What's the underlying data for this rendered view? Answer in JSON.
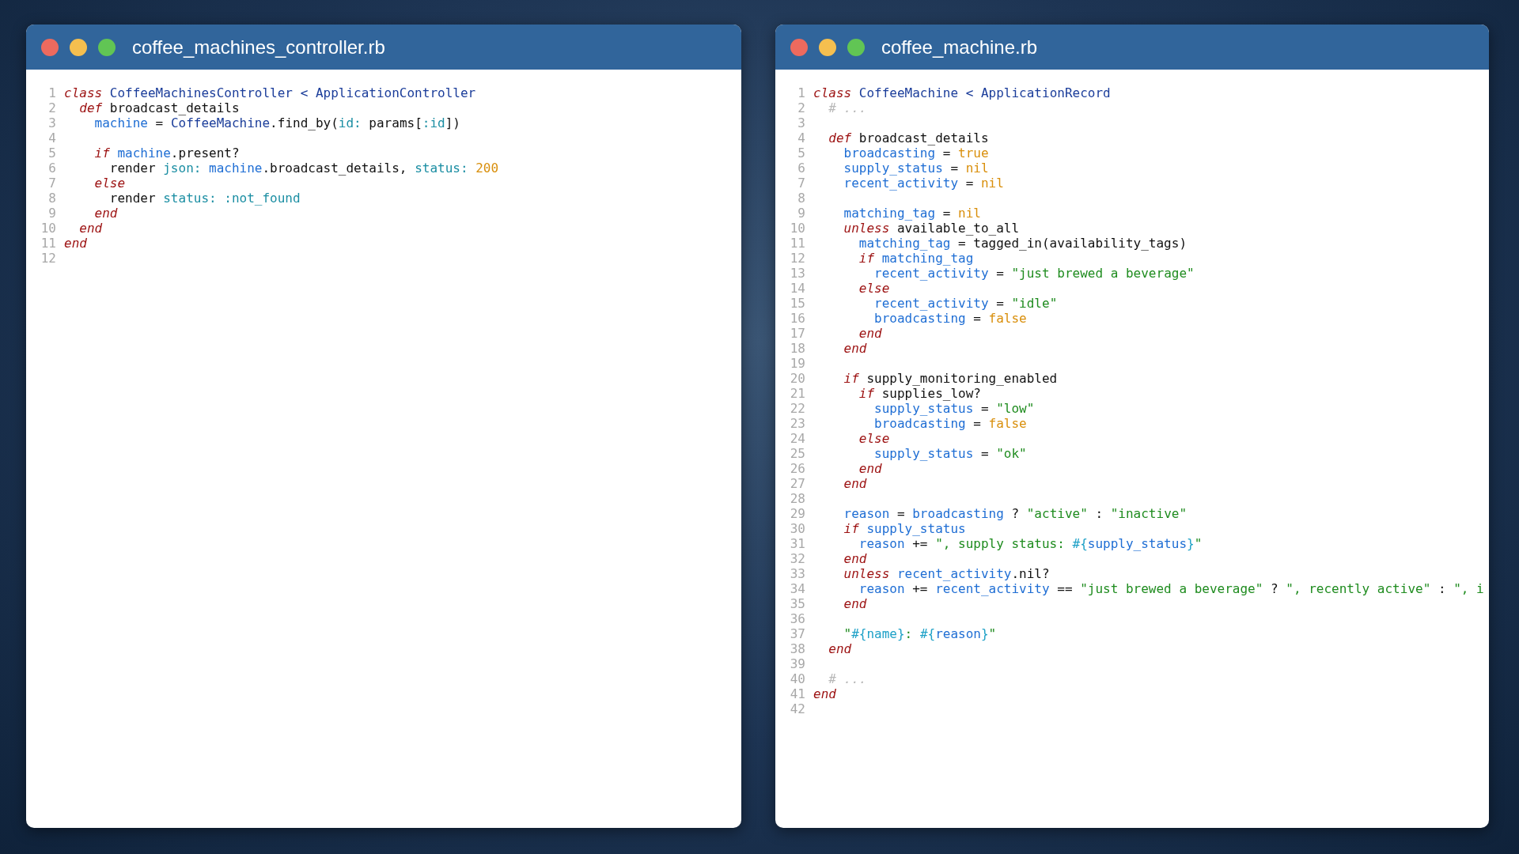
{
  "windows": [
    {
      "title": "coffee_machines_controller.rb",
      "lines": [
        {
          "number": "1",
          "tokens": [
            {
              "kind": "keyword",
              "text": "class"
            },
            {
              "kind": "constant",
              "text": " CoffeeMachinesController < ApplicationController"
            }
          ]
        },
        {
          "number": "2",
          "tokens": [
            {
              "kind": "keyword",
              "text": "  def"
            },
            {
              "kind": "plain",
              "text": " broadcast_details"
            }
          ]
        },
        {
          "number": "3",
          "tokens": [
            {
              "kind": "variable",
              "text": "    machine"
            },
            {
              "kind": "plain",
              "text": " = "
            },
            {
              "kind": "constant",
              "text": "CoffeeMachine"
            },
            {
              "kind": "plain",
              "text": ".find_by("
            },
            {
              "kind": "symbol",
              "text": "id:"
            },
            {
              "kind": "plain",
              "text": " params["
            },
            {
              "kind": "symbol",
              "text": ":id"
            },
            {
              "kind": "plain",
              "text": "])"
            }
          ]
        },
        {
          "number": "4"
        },
        {
          "number": "5",
          "tokens": [
            {
              "kind": "keyword",
              "text": "    if"
            },
            {
              "kind": "variable",
              "text": " machine"
            },
            {
              "kind": "plain",
              "text": ".present?"
            }
          ]
        },
        {
          "number": "6",
          "tokens": [
            {
              "kind": "plain",
              "text": "      render "
            },
            {
              "kind": "symbol",
              "text": "json:"
            },
            {
              "kind": "variable",
              "text": " machine"
            },
            {
              "kind": "plain",
              "text": ".broadcast_details, "
            },
            {
              "kind": "symbol",
              "text": "status:"
            },
            {
              "kind": "literal",
              "text": " 200"
            }
          ]
        },
        {
          "number": "7",
          "tokens": [
            {
              "kind": "keyword",
              "text": "    else"
            }
          ]
        },
        {
          "number": "8",
          "tokens": [
            {
              "kind": "plain",
              "text": "      render "
            },
            {
              "kind": "symbol",
              "text": "status: :not_found"
            }
          ]
        },
        {
          "number": "9",
          "tokens": [
            {
              "kind": "keyword",
              "text": "    end"
            }
          ]
        },
        {
          "number": "10",
          "tokens": [
            {
              "kind": "keyword",
              "text": "  end"
            }
          ]
        },
        {
          "number": "11",
          "tokens": [
            {
              "kind": "keyword",
              "text": "end"
            }
          ]
        },
        {
          "number": "12"
        }
      ]
    },
    {
      "title": "coffee_machine.rb",
      "lines": [
        {
          "number": "1",
          "tokens": [
            {
              "kind": "keyword",
              "text": "class"
            },
            {
              "kind": "constant",
              "text": " CoffeeMachine < ApplicationRecord"
            }
          ]
        },
        {
          "number": "2",
          "tokens": [
            {
              "kind": "comment",
              "text": "  # ..."
            }
          ]
        },
        {
          "number": "3"
        },
        {
          "number": "4",
          "tokens": [
            {
              "kind": "keyword",
              "text": "  def"
            },
            {
              "kind": "plain",
              "text": " broadcast_details"
            }
          ]
        },
        {
          "number": "5",
          "tokens": [
            {
              "kind": "variable",
              "text": "    broadcasting"
            },
            {
              "kind": "plain",
              "text": " = "
            },
            {
              "kind": "literal",
              "text": "true"
            }
          ]
        },
        {
          "number": "6",
          "tokens": [
            {
              "kind": "variable",
              "text": "    supply_status"
            },
            {
              "kind": "plain",
              "text": " = "
            },
            {
              "kind": "literal",
              "text": "nil"
            }
          ]
        },
        {
          "number": "7",
          "tokens": [
            {
              "kind": "variable",
              "text": "    recent_activity"
            },
            {
              "kind": "plain",
              "text": " = "
            },
            {
              "kind": "literal",
              "text": "nil"
            }
          ]
        },
        {
          "number": "8"
        },
        {
          "number": "9",
          "tokens": [
            {
              "kind": "variable",
              "text": "    matching_tag"
            },
            {
              "kind": "plain",
              "text": " = "
            },
            {
              "kind": "literal",
              "text": "nil"
            }
          ]
        },
        {
          "number": "10",
          "tokens": [
            {
              "kind": "keyword",
              "text": "    unless"
            },
            {
              "kind": "plain",
              "text": " available_to_all"
            }
          ]
        },
        {
          "number": "11",
          "tokens": [
            {
              "kind": "variable",
              "text": "      matching_tag"
            },
            {
              "kind": "plain",
              "text": " = tagged_in(availability_tags)"
            }
          ]
        },
        {
          "number": "12",
          "tokens": [
            {
              "kind": "keyword",
              "text": "      if"
            },
            {
              "kind": "variable",
              "text": " matching_tag"
            }
          ]
        },
        {
          "number": "13",
          "tokens": [
            {
              "kind": "variable",
              "text": "        recent_activity"
            },
            {
              "kind": "plain",
              "text": " = "
            },
            {
              "kind": "string",
              "text": "\"just brewed a beverage\""
            }
          ]
        },
        {
          "number": "14",
          "tokens": [
            {
              "kind": "keyword",
              "text": "      else"
            }
          ]
        },
        {
          "number": "15",
          "tokens": [
            {
              "kind": "variable",
              "text": "        recent_activity"
            },
            {
              "kind": "plain",
              "text": " = "
            },
            {
              "kind": "string",
              "text": "\"idle\""
            }
          ]
        },
        {
          "number": "16",
          "tokens": [
            {
              "kind": "variable",
              "text": "        broadcasting"
            },
            {
              "kind": "plain",
              "text": " = "
            },
            {
              "kind": "literal",
              "text": "false"
            }
          ]
        },
        {
          "number": "17",
          "tokens": [
            {
              "kind": "keyword",
              "text": "      end"
            }
          ]
        },
        {
          "number": "18",
          "tokens": [
            {
              "kind": "keyword",
              "text": "    end"
            }
          ]
        },
        {
          "number": "19"
        },
        {
          "number": "20",
          "tokens": [
            {
              "kind": "keyword",
              "text": "    if"
            },
            {
              "kind": "plain",
              "text": " supply_monitoring_enabled"
            }
          ]
        },
        {
          "number": "21",
          "tokens": [
            {
              "kind": "keyword",
              "text": "      if"
            },
            {
              "kind": "plain",
              "text": " supplies_low?"
            }
          ]
        },
        {
          "number": "22",
          "tokens": [
            {
              "kind": "variable",
              "text": "        supply_status"
            },
            {
              "kind": "plain",
              "text": " = "
            },
            {
              "kind": "string",
              "text": "\"low\""
            }
          ]
        },
        {
          "number": "23",
          "tokens": [
            {
              "kind": "variable",
              "text": "        broadcasting"
            },
            {
              "kind": "plain",
              "text": " = "
            },
            {
              "kind": "literal",
              "text": "false"
            }
          ]
        },
        {
          "number": "24",
          "tokens": [
            {
              "kind": "keyword",
              "text": "      else"
            }
          ]
        },
        {
          "number": "25",
          "tokens": [
            {
              "kind": "variable",
              "text": "        supply_status"
            },
            {
              "kind": "plain",
              "text": " = "
            },
            {
              "kind": "string",
              "text": "\"ok\""
            }
          ]
        },
        {
          "number": "26",
          "tokens": [
            {
              "kind": "keyword",
              "text": "      end"
            }
          ]
        },
        {
          "number": "27",
          "tokens": [
            {
              "kind": "keyword",
              "text": "    end"
            }
          ]
        },
        {
          "number": "28"
        },
        {
          "number": "29",
          "tokens": [
            {
              "kind": "variable",
              "text": "    reason"
            },
            {
              "kind": "plain",
              "text": " = "
            },
            {
              "kind": "variable",
              "text": "broadcasting"
            },
            {
              "kind": "plain",
              "text": " ? "
            },
            {
              "kind": "string",
              "text": "\"active\""
            },
            {
              "kind": "plain",
              "text": " : "
            },
            {
              "kind": "string",
              "text": "\"inactive\""
            }
          ]
        },
        {
          "number": "30",
          "tokens": [
            {
              "kind": "keyword",
              "text": "    if"
            },
            {
              "kind": "variable",
              "text": " supply_status"
            }
          ]
        },
        {
          "number": "31",
          "tokens": [
            {
              "kind": "variable",
              "text": "      reason"
            },
            {
              "kind": "plain",
              "text": " += "
            },
            {
              "kind": "string",
              "text": "\", supply status: "
            },
            {
              "kind": "interpolation",
              "text": "#{"
            },
            {
              "kind": "variable",
              "text": "supply_status"
            },
            {
              "kind": "interpolation",
              "text": "}"
            },
            {
              "kind": "string",
              "text": "\""
            }
          ]
        },
        {
          "number": "32",
          "tokens": [
            {
              "kind": "keyword",
              "text": "    end"
            }
          ]
        },
        {
          "number": "33",
          "tokens": [
            {
              "kind": "keyword",
              "text": "    unless"
            },
            {
              "kind": "variable",
              "text": " recent_activity"
            },
            {
              "kind": "plain",
              "text": ".nil?"
            }
          ]
        },
        {
          "number": "34",
          "tokens": [
            {
              "kind": "variable",
              "text": "      reason"
            },
            {
              "kind": "plain",
              "text": " += "
            },
            {
              "kind": "variable",
              "text": "recent_activity"
            },
            {
              "kind": "plain",
              "text": " == "
            },
            {
              "kind": "string",
              "text": "\"just brewed a beverage\""
            },
            {
              "kind": "plain",
              "text": " ? "
            },
            {
              "kind": "string",
              "text": "\", recently active\""
            },
            {
              "kind": "plain",
              "text": " : "
            },
            {
              "kind": "string",
              "text": "\", i"
            }
          ]
        },
        {
          "number": "35",
          "tokens": [
            {
              "kind": "keyword",
              "text": "    end"
            }
          ]
        },
        {
          "number": "36"
        },
        {
          "number": "37",
          "tokens": [
            {
              "kind": "string",
              "text": "    \""
            },
            {
              "kind": "interpolation",
              "text": "#{name}"
            },
            {
              "kind": "string",
              "text": ": "
            },
            {
              "kind": "interpolation",
              "text": "#{"
            },
            {
              "kind": "variable",
              "text": "reason"
            },
            {
              "kind": "interpolation",
              "text": "}"
            },
            {
              "kind": "string",
              "text": "\""
            }
          ]
        },
        {
          "number": "38",
          "tokens": [
            {
              "kind": "keyword",
              "text": "  end"
            }
          ]
        },
        {
          "number": "39"
        },
        {
          "number": "40",
          "tokens": [
            {
              "kind": "comment",
              "text": "  # ..."
            }
          ]
        },
        {
          "number": "41",
          "tokens": [
            {
              "kind": "keyword",
              "text": "end"
            }
          ]
        },
        {
          "number": "42"
        }
      ]
    }
  ]
}
